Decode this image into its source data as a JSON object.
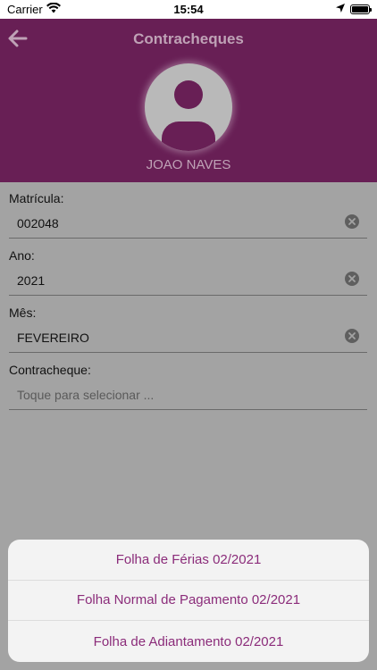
{
  "status_bar": {
    "carrier": "Carrier",
    "time": "15:54"
  },
  "header": {
    "title": "Contracheques",
    "user_name": "JOAO NAVES",
    "background_color": "#681f55"
  },
  "form": {
    "matricula": {
      "label": "Matrícula:",
      "value": "002048"
    },
    "ano": {
      "label": "Ano:",
      "value": "2021"
    },
    "mes": {
      "label": "Mês:",
      "value": "FEVEREIRO"
    },
    "contracheque": {
      "label": "Contracheque:",
      "placeholder": "Toque para selecionar ..."
    }
  },
  "action_sheet": {
    "items": [
      {
        "label": "Folha de Férias 02/2021"
      },
      {
        "label": "Folha Normal de Pagamento 02/2021"
      },
      {
        "label": "Folha de Adiantamento 02/2021"
      }
    ],
    "text_color": "#8b2c7a"
  },
  "icons": {
    "back": "arrow-left-icon",
    "avatar": "user-silhouette-icon",
    "clear": "clear-circle-icon"
  }
}
